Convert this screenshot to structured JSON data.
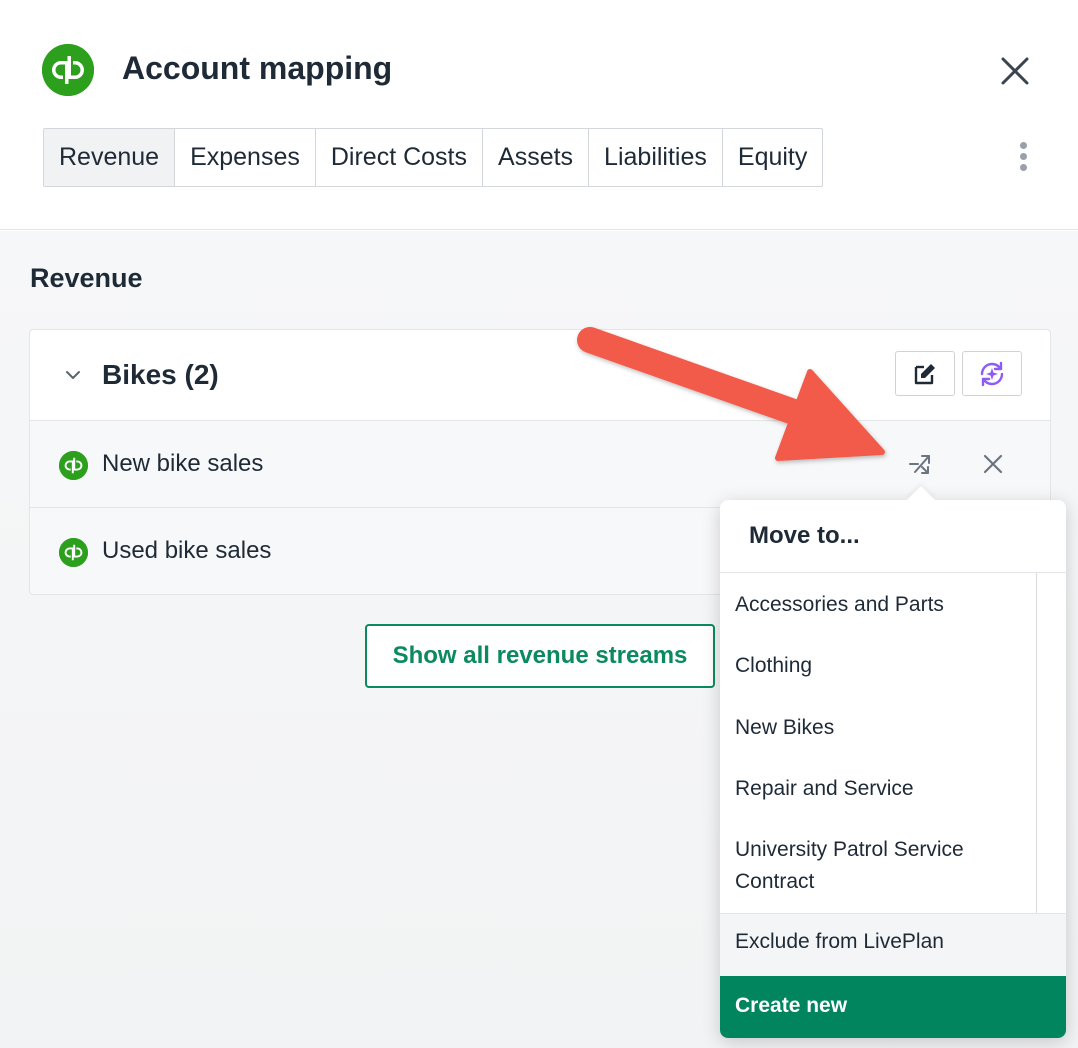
{
  "header": {
    "title": "Account mapping",
    "tabs": [
      {
        "label": "Revenue",
        "active": true
      },
      {
        "label": "Expenses",
        "active": false
      },
      {
        "label": "Direct Costs",
        "active": false
      },
      {
        "label": "Assets",
        "active": false
      },
      {
        "label": "Liabilities",
        "active": false
      },
      {
        "label": "Equity",
        "active": false
      }
    ]
  },
  "main": {
    "section_title": "Revenue",
    "group": {
      "title": "Bikes (2)",
      "actions": [
        "edit-icon",
        "sync-icon"
      ],
      "rows": [
        {
          "label": "New bike sales",
          "icon": "quickbooks-icon"
        },
        {
          "label": "Used bike sales",
          "icon": "quickbooks-icon"
        }
      ]
    },
    "show_all_label": "Show all revenue streams"
  },
  "dropdown": {
    "title": "Move to...",
    "options": [
      "Accessories and Parts",
      "Clothing",
      "New Bikes",
      "Repair and Service",
      "University Patrol Service Contract"
    ],
    "exclude_label": "Exclude from LivePlan",
    "create_label": "Create new"
  },
  "colors": {
    "brand_green": "#2ca01c",
    "accent_green": "#00855f",
    "annotation_arrow": "#f25a4a"
  }
}
